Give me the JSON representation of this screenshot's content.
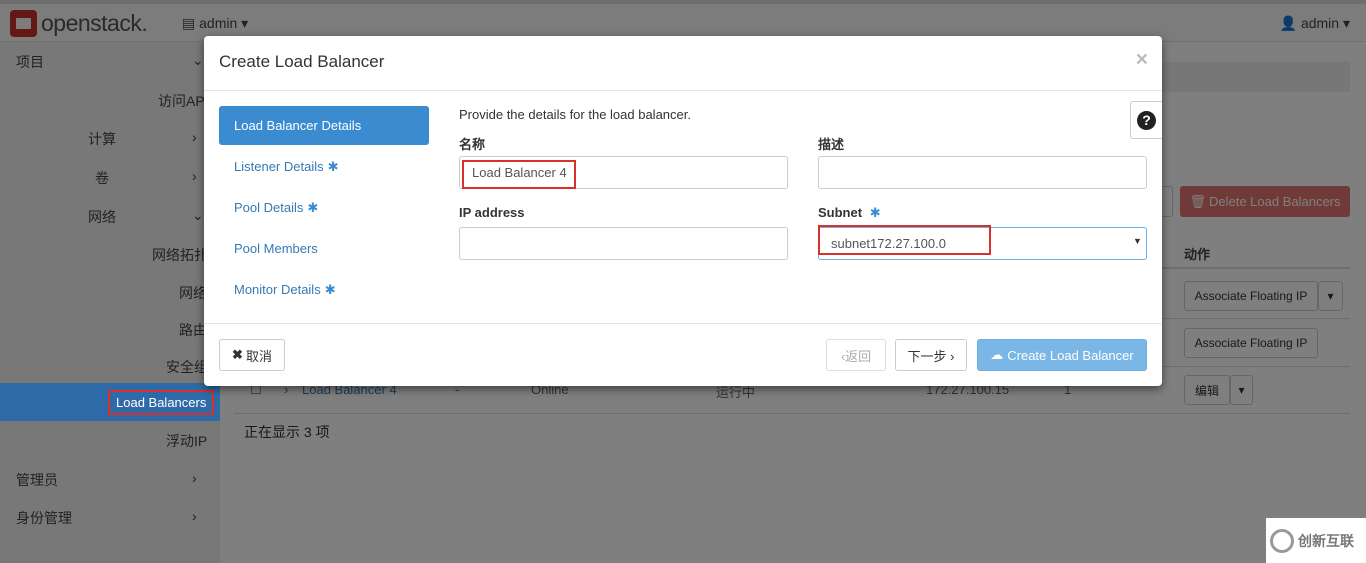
{
  "app": {
    "logo_text": "openstack.",
    "project": "admin",
    "user": "admin"
  },
  "sidebar": {
    "items": [
      {
        "label": "项目",
        "chev": "⌄"
      },
      {
        "label": "访问API"
      },
      {
        "label": "计算",
        "chev": "›"
      },
      {
        "label": "卷",
        "chev": "›"
      },
      {
        "label": "网络",
        "chev": "⌄"
      },
      {
        "label": "网络拓扑"
      },
      {
        "label": "网络"
      },
      {
        "label": "路由"
      },
      {
        "label": "安全组"
      },
      {
        "label": "Load Balancers"
      },
      {
        "label": "浮动IP"
      },
      {
        "label": "管理员",
        "chev": "›"
      },
      {
        "label": "身份管理",
        "chev": "›"
      }
    ]
  },
  "page": {
    "delete_button": "Delete Load Balancers",
    "col_action": "动作",
    "row_actions": [
      "Associate Floating IP",
      "Associate Floating IP",
      "编辑"
    ],
    "row3": {
      "name": "Load Balancer 4",
      "desc": "-",
      "status": "Online",
      "op": "运行中",
      "ip": "172.27.100.15",
      "count": "1"
    },
    "showing": "正在显示 3 项"
  },
  "modal": {
    "title": "Create Load Balancer",
    "close": "×",
    "steps": [
      {
        "label": "Load Balancer Details",
        "required": false,
        "active": true
      },
      {
        "label": "Listener Details",
        "required": true,
        "active": false
      },
      {
        "label": "Pool Details",
        "required": true,
        "active": false
      },
      {
        "label": "Pool Members",
        "required": false,
        "active": false
      },
      {
        "label": "Monitor Details",
        "required": true,
        "active": false
      }
    ],
    "required_mark": "✱",
    "intro": "Provide the details for the load balancer.",
    "fields": {
      "name_label": "名称",
      "name_value": "Load Balancer 4",
      "desc_label": "描述",
      "desc_value": "",
      "ip_label": "IP address",
      "ip_value": "",
      "subnet_label": "Subnet",
      "subnet_value": "subnet172.27.100.0"
    },
    "buttons": {
      "cancel": "取消",
      "back": "‹返回",
      "next": "下一步 ›",
      "create": "Create Load Balancer"
    }
  },
  "watermark": "创新互联"
}
